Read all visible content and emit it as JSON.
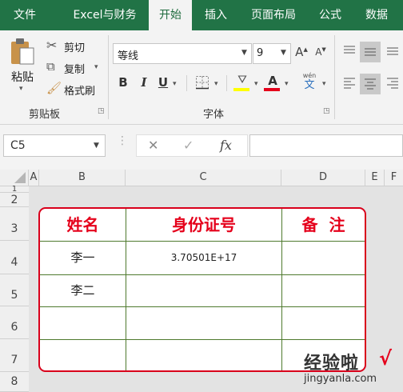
{
  "tabs": [
    "文件",
    "Excel与财务",
    "开始",
    "插入",
    "页面布局",
    "公式",
    "数据"
  ],
  "clipboard": {
    "paste": "粘贴",
    "cut": "剪切",
    "copy": "复制",
    "format_painter": "格式刷",
    "group": "剪贴板"
  },
  "font": {
    "name": "等线",
    "size": "9",
    "grow": "A",
    "shrink": "A",
    "bold": "B",
    "italic": "I",
    "underline": "U",
    "color_glyph": "A",
    "pinyin_top": "wén",
    "pinyin_bottom": "文",
    "group": "字体"
  },
  "formula_bar": {
    "name_box": "C5",
    "fx": "fx",
    "value": ""
  },
  "columns": [
    "A",
    "B",
    "C",
    "D",
    "E",
    "F"
  ],
  "rows": [
    "1",
    "2",
    "3",
    "4",
    "5",
    "6",
    "7",
    "8"
  ],
  "table": {
    "headers": [
      "姓名",
      "身份证号",
      "备  注"
    ],
    "rows": [
      [
        "李一",
        "3.70501E+17",
        ""
      ],
      [
        "李二",
        "",
        ""
      ],
      [
        "",
        "",
        ""
      ],
      [
        "",
        "",
        ""
      ]
    ]
  },
  "watermark": "经验啦",
  "watermark_url": "jingyanla.com",
  "colors": {
    "ribbon": "#217346",
    "header_text": "#e5001b",
    "table_border": "#d9001b"
  }
}
